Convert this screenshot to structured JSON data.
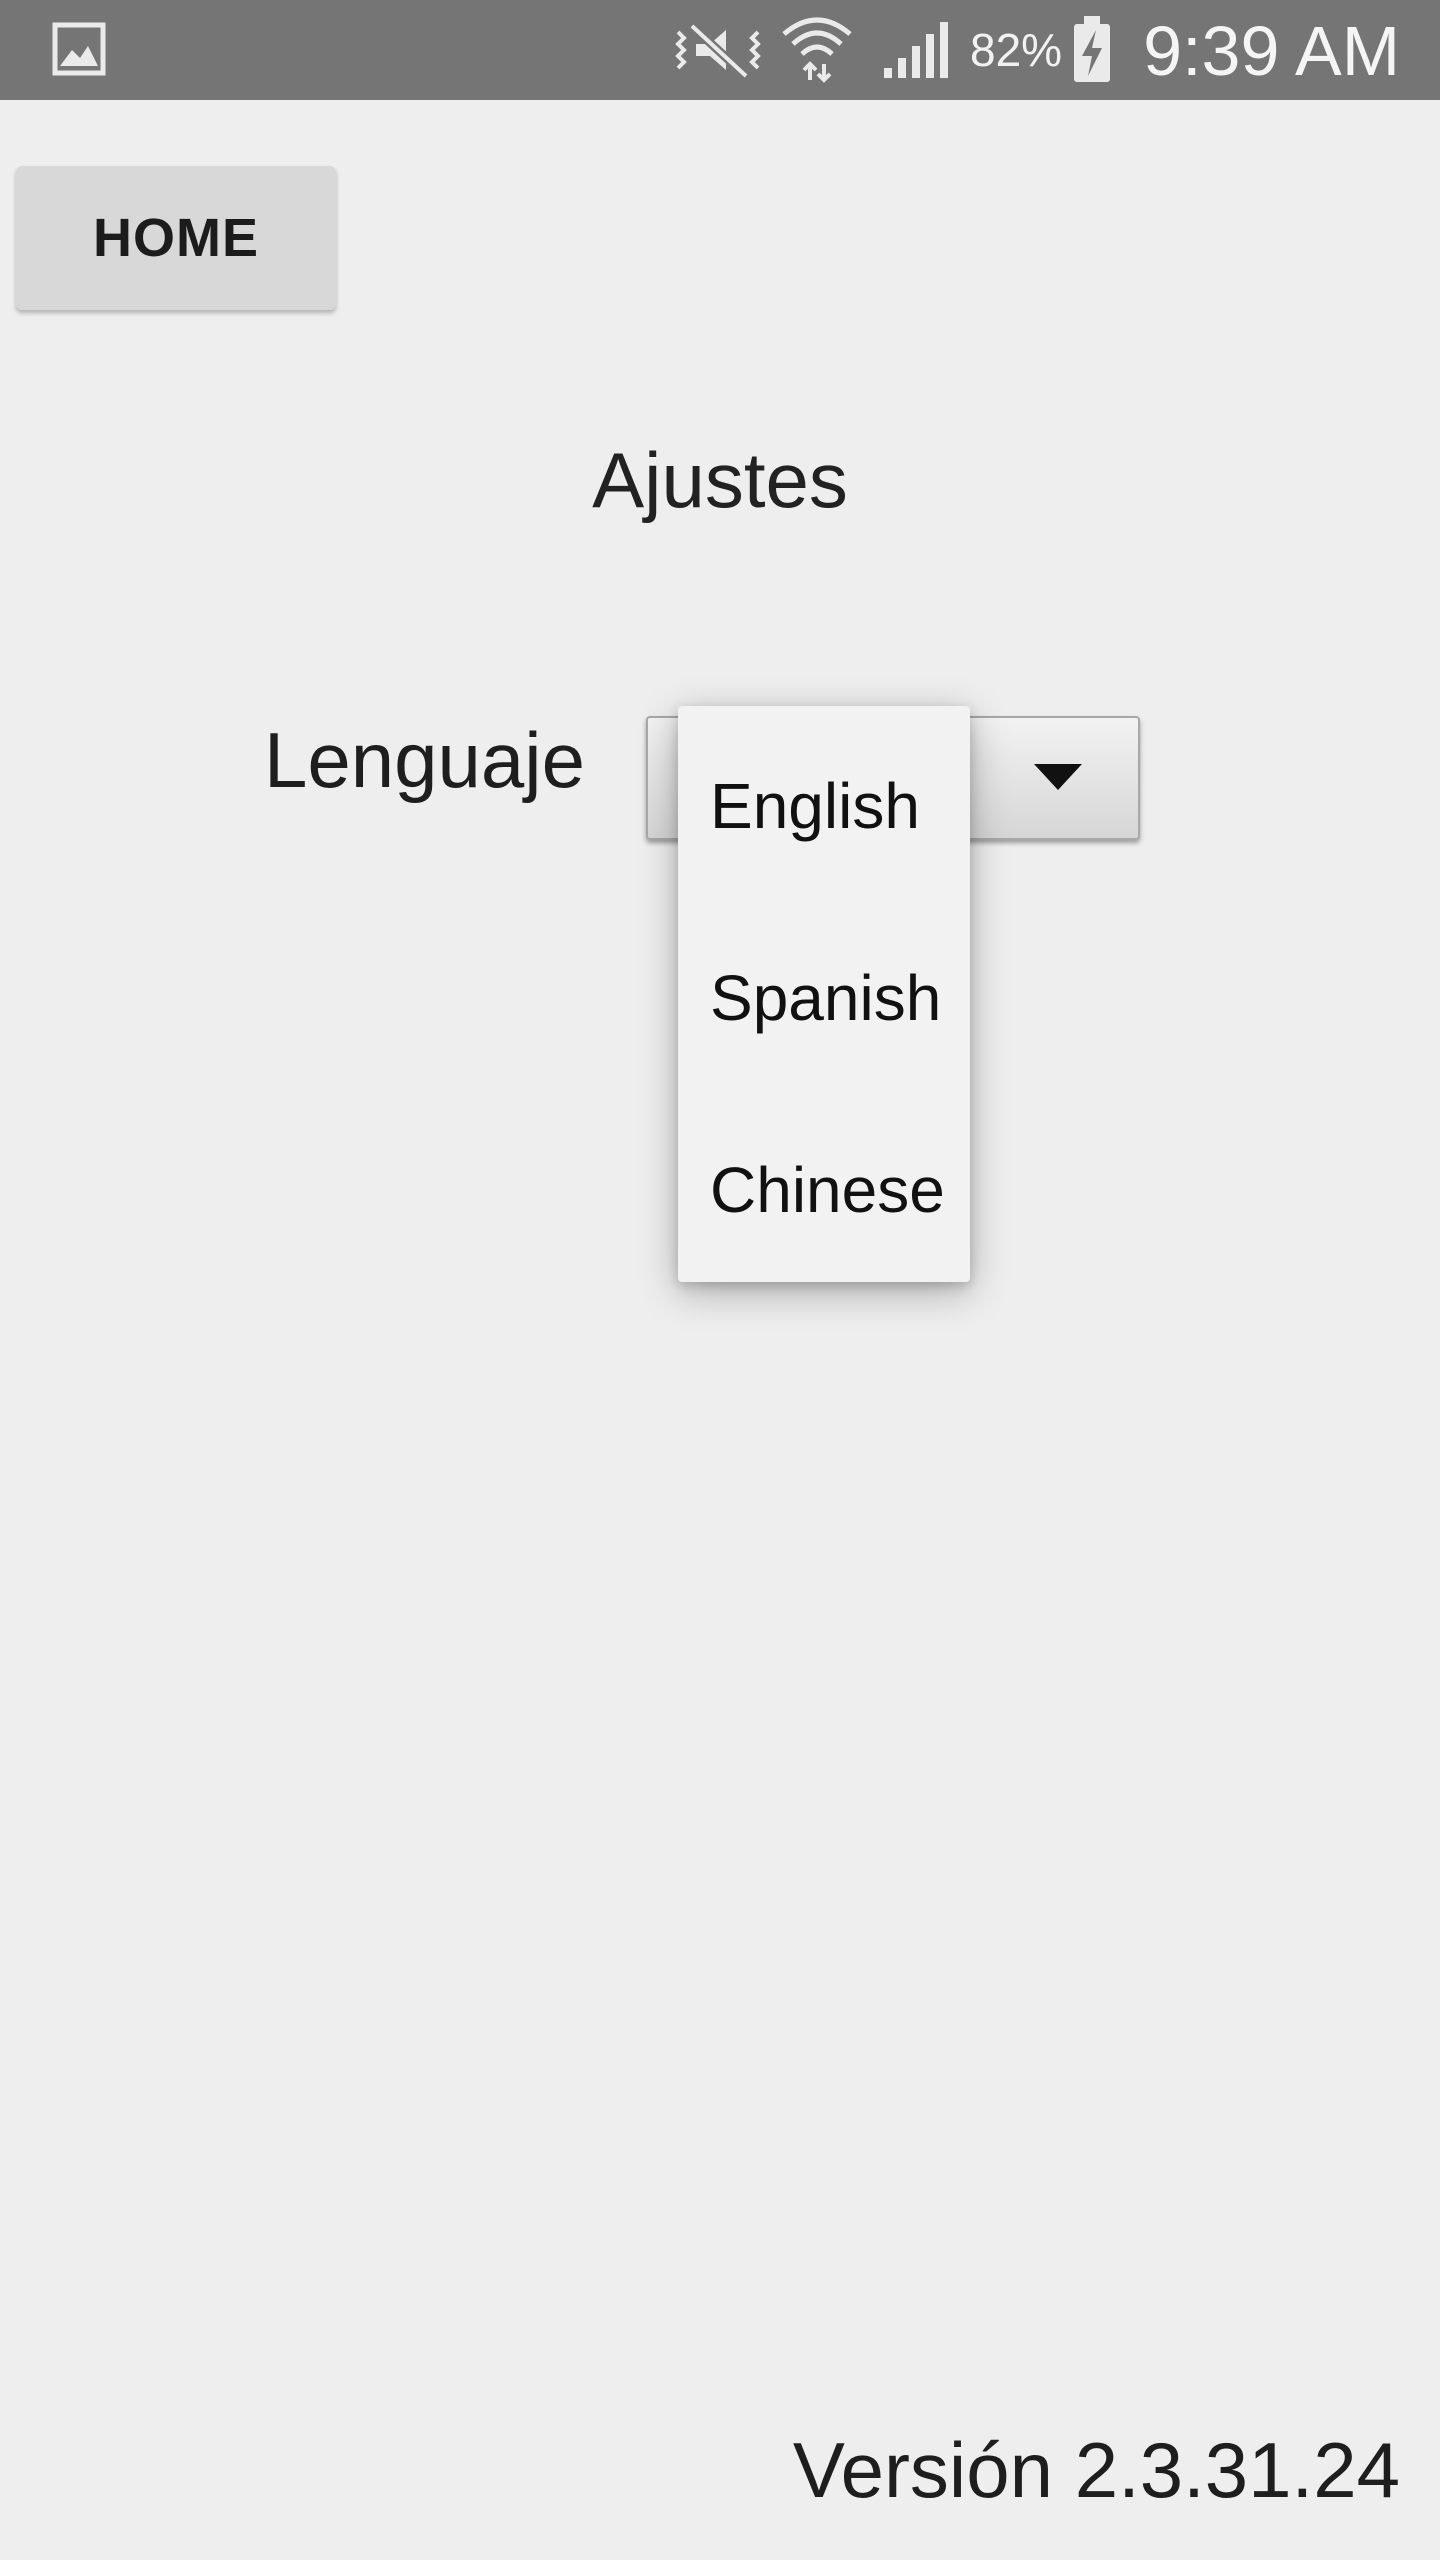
{
  "status_bar": {
    "battery_percent": "82%",
    "time": "9:39 AM",
    "icons": [
      "gallery-icon",
      "vibrate-mute-icon",
      "wifi-icon",
      "signal-icon",
      "battery-charging-icon"
    ]
  },
  "header": {
    "home_label": "HOME"
  },
  "main": {
    "title": "Ajustes",
    "language_label": "Lenguaje",
    "language_options": [
      "English",
      "Spanish",
      "Chinese"
    ]
  },
  "footer": {
    "version": "Versión 2.3.31.24"
  }
}
